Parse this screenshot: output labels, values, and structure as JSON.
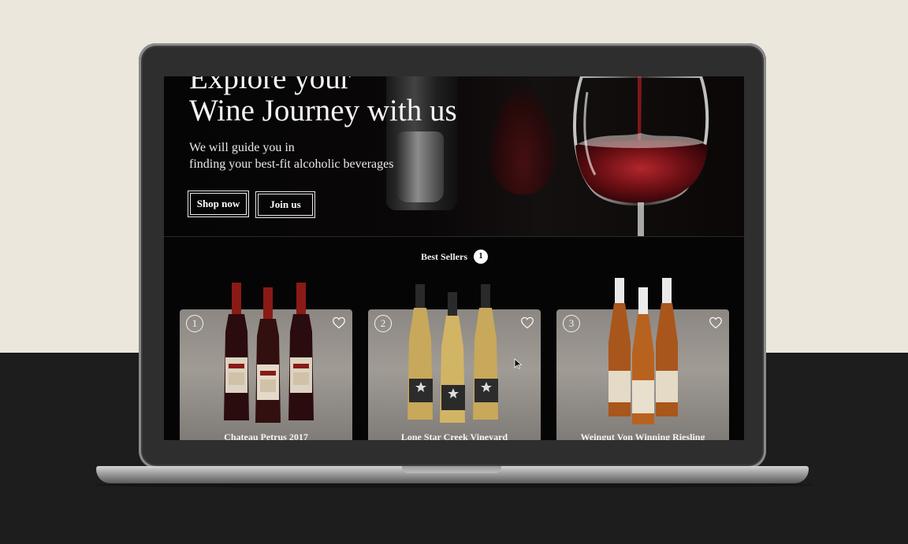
{
  "hero": {
    "headline_line1": "Explore your",
    "headline_line2": "Wine Journey with us",
    "subtitle_line1": "We will guide you in",
    "subtitle_line2": "finding  your best-fit alcoholic beverages",
    "shop_button": "Shop now",
    "join_button": "Join us"
  },
  "best_sellers": {
    "title": "Best Sellers",
    "badge": "1",
    "products": [
      {
        "rank": "1",
        "name": "Chateau Petrus 2017"
      },
      {
        "rank": "2",
        "name": "Lone Star Creek Vineyard"
      },
      {
        "rank": "3",
        "name": "Weingut Von Winning Riesling"
      }
    ]
  },
  "colors": {
    "page_background": "#ece7dc",
    "desk": "#1d1d1d",
    "screen_background": "#050505",
    "card_background": "#9a9590",
    "text": "#f4f4f4"
  },
  "icons": [
    "heart-icon",
    "wine-glass-icon",
    "cursor-icon"
  ]
}
